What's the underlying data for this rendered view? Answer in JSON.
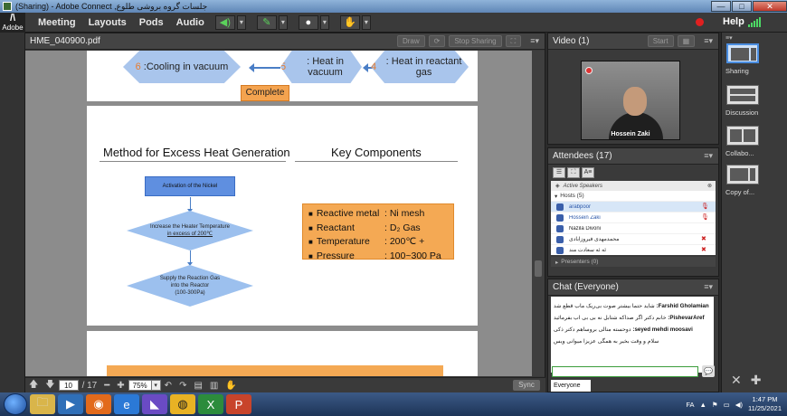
{
  "window": {
    "title": "(Sharing) - Adobe Connect ,جلسات گروه بروشی طلوع",
    "buttons": [
      "—",
      "□",
      "✕"
    ]
  },
  "menubar": {
    "logo": "Adobe",
    "items": [
      "Meeting",
      "Layouts",
      "Pods",
      "Audio"
    ],
    "help": "Help"
  },
  "share_pod": {
    "title": "HME_040900.pdf",
    "draw_button": "Draw",
    "stop_sharing_button": "Stop Sharing",
    "menu_icon": "≡▾",
    "slide1": {
      "step6": {
        "num": "6",
        "text": ":Cooling in vacuum"
      },
      "step5": {
        "num": "5",
        "text": ": Heat in vacuum"
      },
      "step4": {
        "num": "4",
        "text": ": Heat in reactant gas"
      },
      "complete": "Complete"
    },
    "slide2": {
      "heading_left": "Method for Excess Heat Generation",
      "heading_right": "Key Components",
      "flow_box": "Activation of the Nickel",
      "diamond1_line1": "Increase the Heater Temperature",
      "diamond1_line2": "in excess of 200℃",
      "diamond2_line1": "Supply the Reaction Gas",
      "diamond2_line2": "into the Reactor",
      "diamond2_line3": "(100-300Pa)",
      "components": [
        {
          "key": "Reactive metal",
          "value": ": Ni mesh"
        },
        {
          "key": "Reactant",
          "value": ": D₂ Gas"
        },
        {
          "key": "Temperature",
          "value": ": 200℃ +"
        },
        {
          "key": "Pressure",
          "value": ": 100~300 Pa"
        }
      ]
    },
    "bottom": {
      "page_current": "10",
      "page_total": "/ 17",
      "zoom": "75%",
      "sync": "Sync"
    }
  },
  "video_pod": {
    "title": "Video",
    "count": "(1)",
    "start_button": "Start",
    "participant": "Hossein Zaki"
  },
  "attendees_pod": {
    "title": "Attendees",
    "count": "(17)",
    "active_speakers": "Active Speakers",
    "hosts_label": "Hosts (5)",
    "hosts": [
      {
        "name": "arabpoor",
        "highlight": true
      },
      {
        "name": "Hossein Zaki",
        "highlight": true
      },
      {
        "name": "Nazila Divoni",
        "highlight": false
      },
      {
        "name": "محمدمهدی فیروزآبادی",
        "highlight": false
      },
      {
        "name": "ئه ئه سعادت مند",
        "highlight": false
      }
    ],
    "presenters_label": "Presenters (0)"
  },
  "chat_pod": {
    "title": "Chat",
    "scope": "(Everyone)",
    "messages": [
      {
        "sender": "Farshid Gholamian:",
        "text": "شاید حتما بیشتر صوت بی‌ریک ماب قطع شد"
      },
      {
        "sender": "PishevarAref:",
        "text": "خانم دکتر اگر صداکه شتابل نه بی بی اب بفرمائید"
      },
      {
        "sender": "seyed mehdi moosavi:",
        "text": "دوحسته منالی بروساهم دکتر ذکی"
      },
      {
        "sender": "",
        "text": "سلام و وقت بخیر به همگی عزیزا میوانی ویس"
      }
    ],
    "tab": "Everyone"
  },
  "layouts_panel": {
    "labels": [
      "Sharing",
      "Discussion",
      "Collabo...",
      "Copy of..."
    ]
  },
  "taskbar": {
    "lang": "FA",
    "time": "1:47 PM",
    "date": "11/25/2021"
  }
}
